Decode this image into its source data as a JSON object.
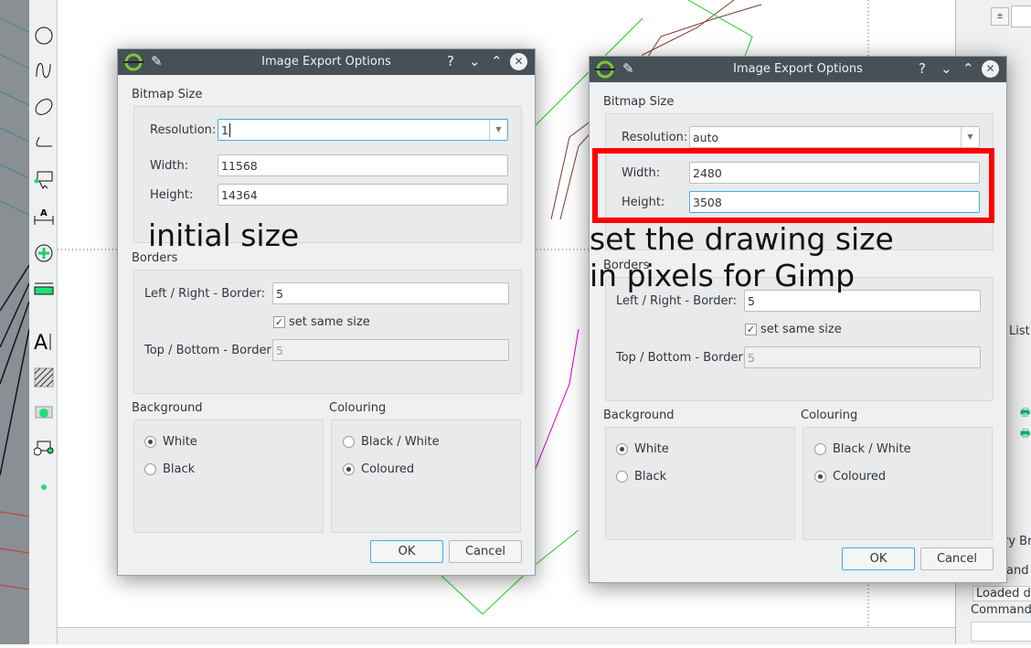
{
  "dialogs": [
    {
      "title": "Image Export Options",
      "bitmap_size": "Bitmap Size",
      "resolution_label": "Resolution:",
      "resolution": "1",
      "width_label": "Width:",
      "width": "11568",
      "height_label": "Height:",
      "height": "14364",
      "borders": "Borders",
      "lr_label": "Left / Right - Border:",
      "lr": "5",
      "same_size": "set same size",
      "tb_label": "Top / Bottom - Border:",
      "tb": "5",
      "background": "Background",
      "white": "White",
      "black": "Black",
      "colouring": "Colouring",
      "bw": "Black / White",
      "coloured": "Coloured",
      "ok": "OK",
      "cancel": "Cancel",
      "help": "?",
      "min": "⌄",
      "max": "⌃",
      "close": "✕"
    },
    {
      "title": "Image Export Options",
      "bitmap_size": "Bitmap Size",
      "resolution_label": "Resolution:",
      "resolution": "auto",
      "width_label": "Width:",
      "width": "2480",
      "height_label": "Height:",
      "height": "3508",
      "borders": "Borders",
      "lr_label": "Left / Right - Border:",
      "lr": "5",
      "same_size": "set same size",
      "tb_label": "Top / Bottom - Border:",
      "tb": "5",
      "background": "Background",
      "white": "White",
      "black": "Black",
      "colouring": "Colouring",
      "bw": "Black / White",
      "coloured": "Coloured",
      "ok": "OK",
      "cancel": "Cancel",
      "help": "?",
      "min": "⌄",
      "max": "⌃",
      "close": "✕"
    }
  ],
  "annotations": {
    "initial": "initial size",
    "set1": "set the drawing size",
    "set2": "in pixels for Gimp"
  },
  "right_panel": {
    "list": "List",
    "browser": "ry Br",
    "command_output": "and",
    "loaded": "Loaded do",
    "command": "Command:"
  },
  "colors": {
    "highlight": "#ff0000",
    "accent": "#3daee9"
  }
}
